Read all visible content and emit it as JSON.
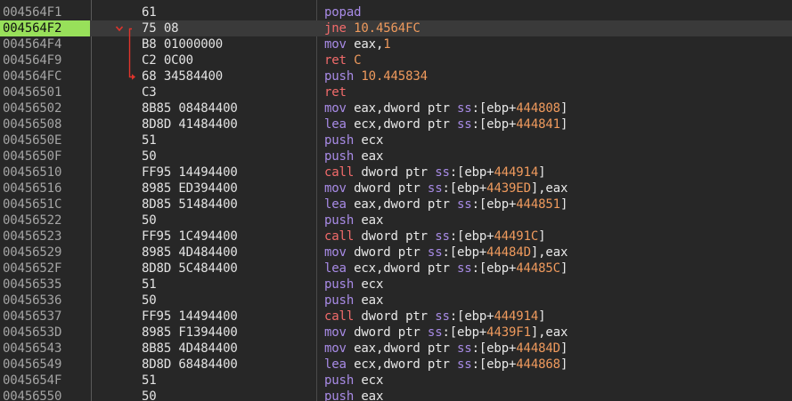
{
  "colors": {
    "background": "#272727",
    "selected_row": "#3a3a3a",
    "selected_address": "#98e05a",
    "address_text": "#a4a4a4",
    "mnemonic": "#a88be6",
    "branch_mnemonic": "#f26b6b",
    "number": "#ef9a5d",
    "jump_arrow": "#e0342c"
  },
  "rows": [
    {
      "addr": "004564F1",
      "bytes": "61",
      "parts": [
        {
          "t": "popad",
          "c": "m-popad"
        }
      ]
    },
    {
      "addr": "004564F2",
      "bytes": "75 08",
      "selected": true,
      "parts": [
        {
          "t": "jne ",
          "c": "m-jne"
        },
        {
          "t": "10.4564FC",
          "c": "t-num"
        }
      ]
    },
    {
      "addr": "004564F4",
      "bytes": "B8 01000000",
      "parts": [
        {
          "t": "mov ",
          "c": "m-mov"
        },
        {
          "t": "eax",
          "c": "t-reg"
        },
        {
          "t": ",",
          "c": "t-op"
        },
        {
          "t": "1",
          "c": "t-num"
        }
      ]
    },
    {
      "addr": "004564F9",
      "bytes": "C2 0C00",
      "parts": [
        {
          "t": "ret ",
          "c": "m-ret"
        },
        {
          "t": "C",
          "c": "t-num"
        }
      ]
    },
    {
      "addr": "004564FC",
      "bytes": "68 34584400",
      "parts": [
        {
          "t": "push ",
          "c": "m-push"
        },
        {
          "t": "10.445834",
          "c": "t-num"
        }
      ]
    },
    {
      "addr": "00456501",
      "bytes": "C3",
      "parts": [
        {
          "t": "ret",
          "c": "m-ret"
        }
      ]
    },
    {
      "addr": "00456502",
      "bytes": "8B85 08484400",
      "parts": [
        {
          "t": "mov ",
          "c": "m-mov"
        },
        {
          "t": "eax,dword ptr ",
          "c": "t-op"
        },
        {
          "t": "ss",
          "c": "t-seg"
        },
        {
          "t": ":[",
          "c": "t-br"
        },
        {
          "t": "ebp",
          "c": "t-reg"
        },
        {
          "t": "+",
          "c": "t-op"
        },
        {
          "t": "444808",
          "c": "t-num"
        },
        {
          "t": "]",
          "c": "t-br"
        }
      ]
    },
    {
      "addr": "00456508",
      "bytes": "8D8D 41484400",
      "parts": [
        {
          "t": "lea ",
          "c": "m-lea"
        },
        {
          "t": "ecx,dword ptr ",
          "c": "t-op"
        },
        {
          "t": "ss",
          "c": "t-seg"
        },
        {
          "t": ":[",
          "c": "t-br"
        },
        {
          "t": "ebp",
          "c": "t-reg"
        },
        {
          "t": "+",
          "c": "t-op"
        },
        {
          "t": "444841",
          "c": "t-num"
        },
        {
          "t": "]",
          "c": "t-br"
        }
      ]
    },
    {
      "addr": "0045650E",
      "bytes": "51",
      "parts": [
        {
          "t": "push ",
          "c": "m-push"
        },
        {
          "t": "ecx",
          "c": "t-reg"
        }
      ]
    },
    {
      "addr": "0045650F",
      "bytes": "50",
      "parts": [
        {
          "t": "push ",
          "c": "m-push"
        },
        {
          "t": "eax",
          "c": "t-reg"
        }
      ]
    },
    {
      "addr": "00456510",
      "bytes": "FF95 14494400",
      "parts": [
        {
          "t": "call ",
          "c": "m-call"
        },
        {
          "t": "dword ptr ",
          "c": "t-op"
        },
        {
          "t": "ss",
          "c": "t-seg"
        },
        {
          "t": ":[",
          "c": "t-br"
        },
        {
          "t": "ebp",
          "c": "t-reg"
        },
        {
          "t": "+",
          "c": "t-op"
        },
        {
          "t": "444914",
          "c": "t-num"
        },
        {
          "t": "]",
          "c": "t-br"
        }
      ]
    },
    {
      "addr": "00456516",
      "bytes": "8985 ED394400",
      "parts": [
        {
          "t": "mov ",
          "c": "m-mov"
        },
        {
          "t": "dword ptr ",
          "c": "t-op"
        },
        {
          "t": "ss",
          "c": "t-seg"
        },
        {
          "t": ":[",
          "c": "t-br"
        },
        {
          "t": "ebp",
          "c": "t-reg"
        },
        {
          "t": "+",
          "c": "t-op"
        },
        {
          "t": "4439ED",
          "c": "t-num"
        },
        {
          "t": "],eax",
          "c": "t-br"
        }
      ]
    },
    {
      "addr": "0045651C",
      "bytes": "8D85 51484400",
      "parts": [
        {
          "t": "lea ",
          "c": "m-lea"
        },
        {
          "t": "eax,dword ptr ",
          "c": "t-op"
        },
        {
          "t": "ss",
          "c": "t-seg"
        },
        {
          "t": ":[",
          "c": "t-br"
        },
        {
          "t": "ebp",
          "c": "t-reg"
        },
        {
          "t": "+",
          "c": "t-op"
        },
        {
          "t": "444851",
          "c": "t-num"
        },
        {
          "t": "]",
          "c": "t-br"
        }
      ]
    },
    {
      "addr": "00456522",
      "bytes": "50",
      "parts": [
        {
          "t": "push ",
          "c": "m-push"
        },
        {
          "t": "eax",
          "c": "t-reg"
        }
      ]
    },
    {
      "addr": "00456523",
      "bytes": "FF95 1C494400",
      "parts": [
        {
          "t": "call ",
          "c": "m-call"
        },
        {
          "t": "dword ptr ",
          "c": "t-op"
        },
        {
          "t": "ss",
          "c": "t-seg"
        },
        {
          "t": ":[",
          "c": "t-br"
        },
        {
          "t": "ebp",
          "c": "t-reg"
        },
        {
          "t": "+",
          "c": "t-op"
        },
        {
          "t": "44491C",
          "c": "t-num"
        },
        {
          "t": "]",
          "c": "t-br"
        }
      ]
    },
    {
      "addr": "00456529",
      "bytes": "8985 4D484400",
      "parts": [
        {
          "t": "mov ",
          "c": "m-mov"
        },
        {
          "t": "dword ptr ",
          "c": "t-op"
        },
        {
          "t": "ss",
          "c": "t-seg"
        },
        {
          "t": ":[",
          "c": "t-br"
        },
        {
          "t": "ebp",
          "c": "t-reg"
        },
        {
          "t": "+",
          "c": "t-op"
        },
        {
          "t": "44484D",
          "c": "t-num"
        },
        {
          "t": "],eax",
          "c": "t-br"
        }
      ]
    },
    {
      "addr": "0045652F",
      "bytes": "8D8D 5C484400",
      "parts": [
        {
          "t": "lea ",
          "c": "m-lea"
        },
        {
          "t": "ecx,dword ptr ",
          "c": "t-op"
        },
        {
          "t": "ss",
          "c": "t-seg"
        },
        {
          "t": ":[",
          "c": "t-br"
        },
        {
          "t": "ebp",
          "c": "t-reg"
        },
        {
          "t": "+",
          "c": "t-op"
        },
        {
          "t": "44485C",
          "c": "t-num"
        },
        {
          "t": "]",
          "c": "t-br"
        }
      ]
    },
    {
      "addr": "00456535",
      "bytes": "51",
      "parts": [
        {
          "t": "push ",
          "c": "m-push"
        },
        {
          "t": "ecx",
          "c": "t-reg"
        }
      ]
    },
    {
      "addr": "00456536",
      "bytes": "50",
      "parts": [
        {
          "t": "push ",
          "c": "m-push"
        },
        {
          "t": "eax",
          "c": "t-reg"
        }
      ]
    },
    {
      "addr": "00456537",
      "bytes": "FF95 14494400",
      "parts": [
        {
          "t": "call ",
          "c": "m-call"
        },
        {
          "t": "dword ptr ",
          "c": "t-op"
        },
        {
          "t": "ss",
          "c": "t-seg"
        },
        {
          "t": ":[",
          "c": "t-br"
        },
        {
          "t": "ebp",
          "c": "t-reg"
        },
        {
          "t": "+",
          "c": "t-op"
        },
        {
          "t": "444914",
          "c": "t-num"
        },
        {
          "t": "]",
          "c": "t-br"
        }
      ]
    },
    {
      "addr": "0045653D",
      "bytes": "8985 F1394400",
      "parts": [
        {
          "t": "mov ",
          "c": "m-mov"
        },
        {
          "t": "dword ptr ",
          "c": "t-op"
        },
        {
          "t": "ss",
          "c": "t-seg"
        },
        {
          "t": ":[",
          "c": "t-br"
        },
        {
          "t": "ebp",
          "c": "t-reg"
        },
        {
          "t": "+",
          "c": "t-op"
        },
        {
          "t": "4439F1",
          "c": "t-num"
        },
        {
          "t": "],eax",
          "c": "t-br"
        }
      ]
    },
    {
      "addr": "00456543",
      "bytes": "8B85 4D484400",
      "parts": [
        {
          "t": "mov ",
          "c": "m-mov"
        },
        {
          "t": "eax,dword ptr ",
          "c": "t-op"
        },
        {
          "t": "ss",
          "c": "t-seg"
        },
        {
          "t": ":[",
          "c": "t-br"
        },
        {
          "t": "ebp",
          "c": "t-reg"
        },
        {
          "t": "+",
          "c": "t-op"
        },
        {
          "t": "44484D",
          "c": "t-num"
        },
        {
          "t": "]",
          "c": "t-br"
        }
      ]
    },
    {
      "addr": "00456549",
      "bytes": "8D8D 68484400",
      "parts": [
        {
          "t": "lea ",
          "c": "m-lea"
        },
        {
          "t": "ecx,dword ptr ",
          "c": "t-op"
        },
        {
          "t": "ss",
          "c": "t-seg"
        },
        {
          "t": ":[",
          "c": "t-br"
        },
        {
          "t": "ebp",
          "c": "t-reg"
        },
        {
          "t": "+",
          "c": "t-op"
        },
        {
          "t": "444868",
          "c": "t-num"
        },
        {
          "t": "]",
          "c": "t-br"
        }
      ]
    },
    {
      "addr": "0045654F",
      "bytes": "51",
      "parts": [
        {
          "t": "push ",
          "c": "m-push"
        },
        {
          "t": "ecx",
          "c": "t-reg"
        }
      ]
    },
    {
      "addr": "00456550",
      "bytes": "50",
      "parts": [
        {
          "t": "push ",
          "c": "m-push"
        },
        {
          "t": "eax",
          "c": "t-reg"
        }
      ]
    }
  ]
}
